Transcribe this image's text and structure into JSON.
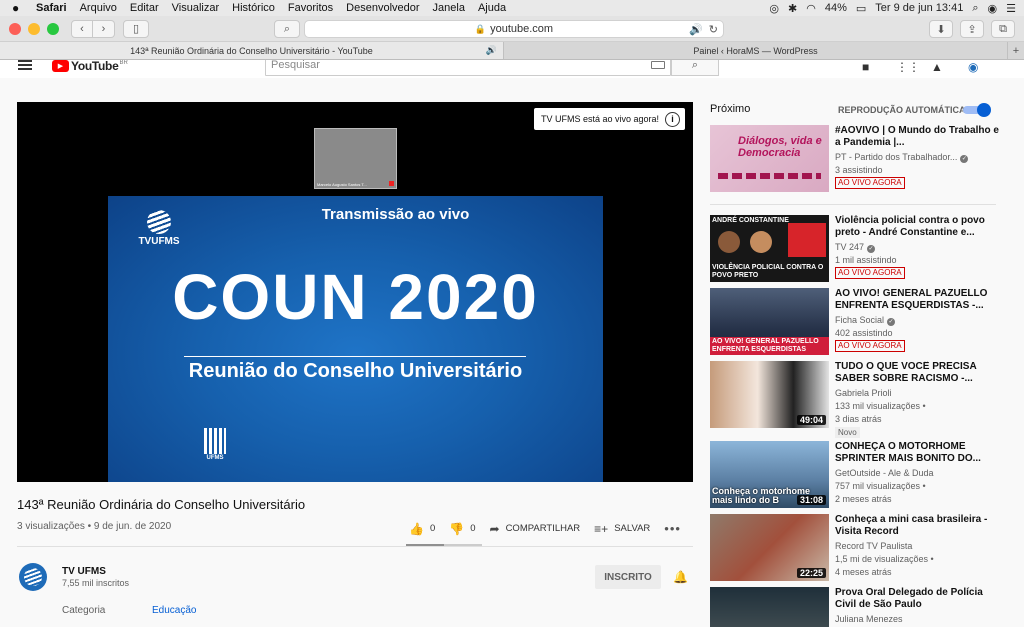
{
  "menubar": {
    "app": "Safari",
    "items": [
      "Arquivo",
      "Editar",
      "Visualizar",
      "Histórico",
      "Favoritos",
      "Desenvolvedor",
      "Janela",
      "Ajuda"
    ],
    "battery": "44%",
    "datetime": "Ter 9 de jun  13:41"
  },
  "browser": {
    "address": "youtube.com",
    "tabs": [
      {
        "label": "143ª Reunião Ordinária do Conselho Universitário - YouTube",
        "active": true
      },
      {
        "label": "Painel ‹ HoraMS — WordPress",
        "active": false
      }
    ]
  },
  "youtube": {
    "logo_text": "YouTube",
    "logo_sup": "BR",
    "search_placeholder": "Pesquisar"
  },
  "video": {
    "live_badge": "TV UFMS está ao vivo agora!",
    "webcam_label": "Marcelo Augusto Santos T...",
    "slide": {
      "logo": "TVUFMS",
      "header": "Transmissão ao vivo",
      "title": "COUN 2020",
      "subtitle": "Reunião do Conselho Universitário",
      "footer_logo": "UFMS"
    },
    "title": "143ª Reunião Ordinária do Conselho Universitário",
    "meta": "3 visualizações • 9 de jun. de 2020",
    "likes": "0",
    "dislikes": "0",
    "share": "COMPARTILHAR",
    "save": "SALVAR",
    "like_ratio": 0.5
  },
  "channel": {
    "name": "TV UFMS",
    "subs": "7,55 mil inscritos",
    "subscribe": "INSCRITO",
    "category_label": "Categoria",
    "category_value": "Educação"
  },
  "sidebar": {
    "up_next": "Próximo",
    "autoplay": "REPRODUÇÃO AUTOMÁTICA",
    "autoplay_on": true,
    "items": [
      {
        "title": "#AOVIVO | O Mundo do Trabalho e a Pandemia |...",
        "channel": "PT - Partido dos Trabalhador...",
        "meta1": "3 assistindo",
        "badge": "AO VIVO AGORA",
        "thumb_text": "Diálogos, vida e Democracia"
      },
      {
        "title": "Violência policial contra o povo preto - André Constantine e...",
        "channel": "TV 247",
        "meta1": "1 mil assistindo",
        "badge": "AO VIVO AGORA",
        "thumb_header": "ANDRÉ CONSTANTINE",
        "thumb_text": "VIOLÊNCIA POLICIAL CONTRA O POVO PRETO"
      },
      {
        "title": "AO VIVO! GENERAL PAZUELLO ENFRENTA ESQUERDISTAS -...",
        "channel": "Ficha Social",
        "meta1": "402 assistindo",
        "badge": "AO VIVO AGORA",
        "thumb_text": "AO VIVO! GENERAL PAZUELLO ENFRENTA ESQUERDISTAS"
      },
      {
        "title": "TUDO O QUE VOCÊ PRECISA SABER SOBRE RACISMO -...",
        "channel": "Gabriela Prioli",
        "meta1": "133 mil visualizações •",
        "meta2": "3 dias atrás",
        "badge_new": "Novo",
        "duration": "49:04"
      },
      {
        "title": "CONHEÇA O MOTORHOME SPRINTER MAIS BONITO DO...",
        "channel": "GetOutside - Ale & Duda",
        "meta1": "757 mil visualizações •",
        "meta2": "2 meses atrás",
        "duration": "31:08",
        "thumb_text": "Conheça o motorhome mais lindo do B"
      },
      {
        "title": "Conheça a mini casa brasileira - Visita Record",
        "channel": "Record TV Paulista",
        "meta1": "1,5 mi de visualizações •",
        "meta2": "4 meses atrás",
        "duration": "22:25"
      },
      {
        "title": "Prova Oral Delegado de Polícia Civil de São Paulo",
        "channel": "Juliana Menezes"
      }
    ]
  }
}
